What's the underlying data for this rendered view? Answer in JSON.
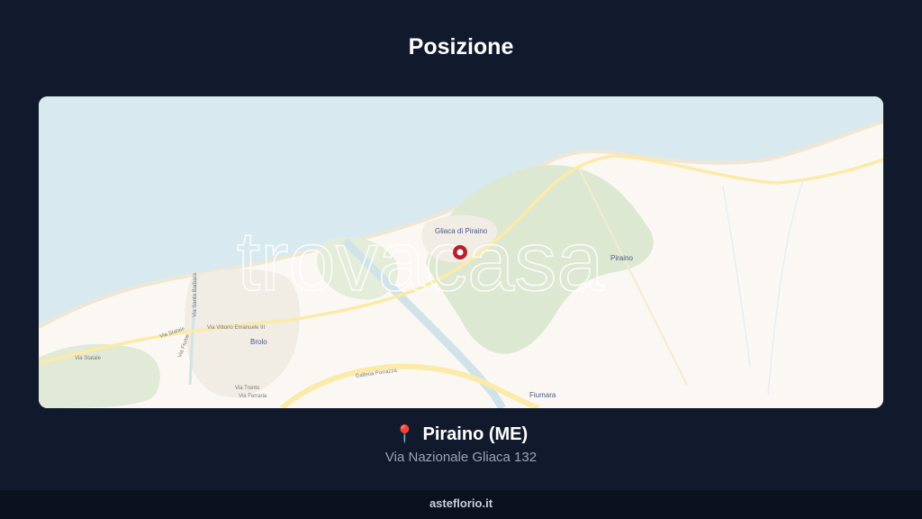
{
  "header": {
    "title": "Posizione"
  },
  "map": {
    "watermark": "trovacasa",
    "labels": {
      "gliaca": "Gliaca di Piraino",
      "piraino": "Piraino",
      "brolo": "Brolo",
      "fiumara": "Fiumara",
      "via_statale_left": "Via Statale",
      "via_statale": "Via Statale",
      "via_vittorio": "Via Vittorio Emanuele III",
      "galleria": "Galleria Porrazza",
      "via_trento": "Via Trento",
      "via_ferraria": "Via Ferraria",
      "via_santa_barbara": "Via Santa Barbara",
      "via_fiume": "Via Fiume"
    },
    "colors": {
      "sea": "#d8eaef",
      "land": "#fbf8f3",
      "green": "#dde8d2",
      "road": "#fbeaa8",
      "river": "#cfe3e8",
      "marker": "#b8202c"
    }
  },
  "location": {
    "pin_icon": "📍",
    "place": "Piraino (ME)",
    "address": "Via Nazionale Gliaca 132"
  },
  "footer": {
    "site": "asteflorio.it"
  }
}
